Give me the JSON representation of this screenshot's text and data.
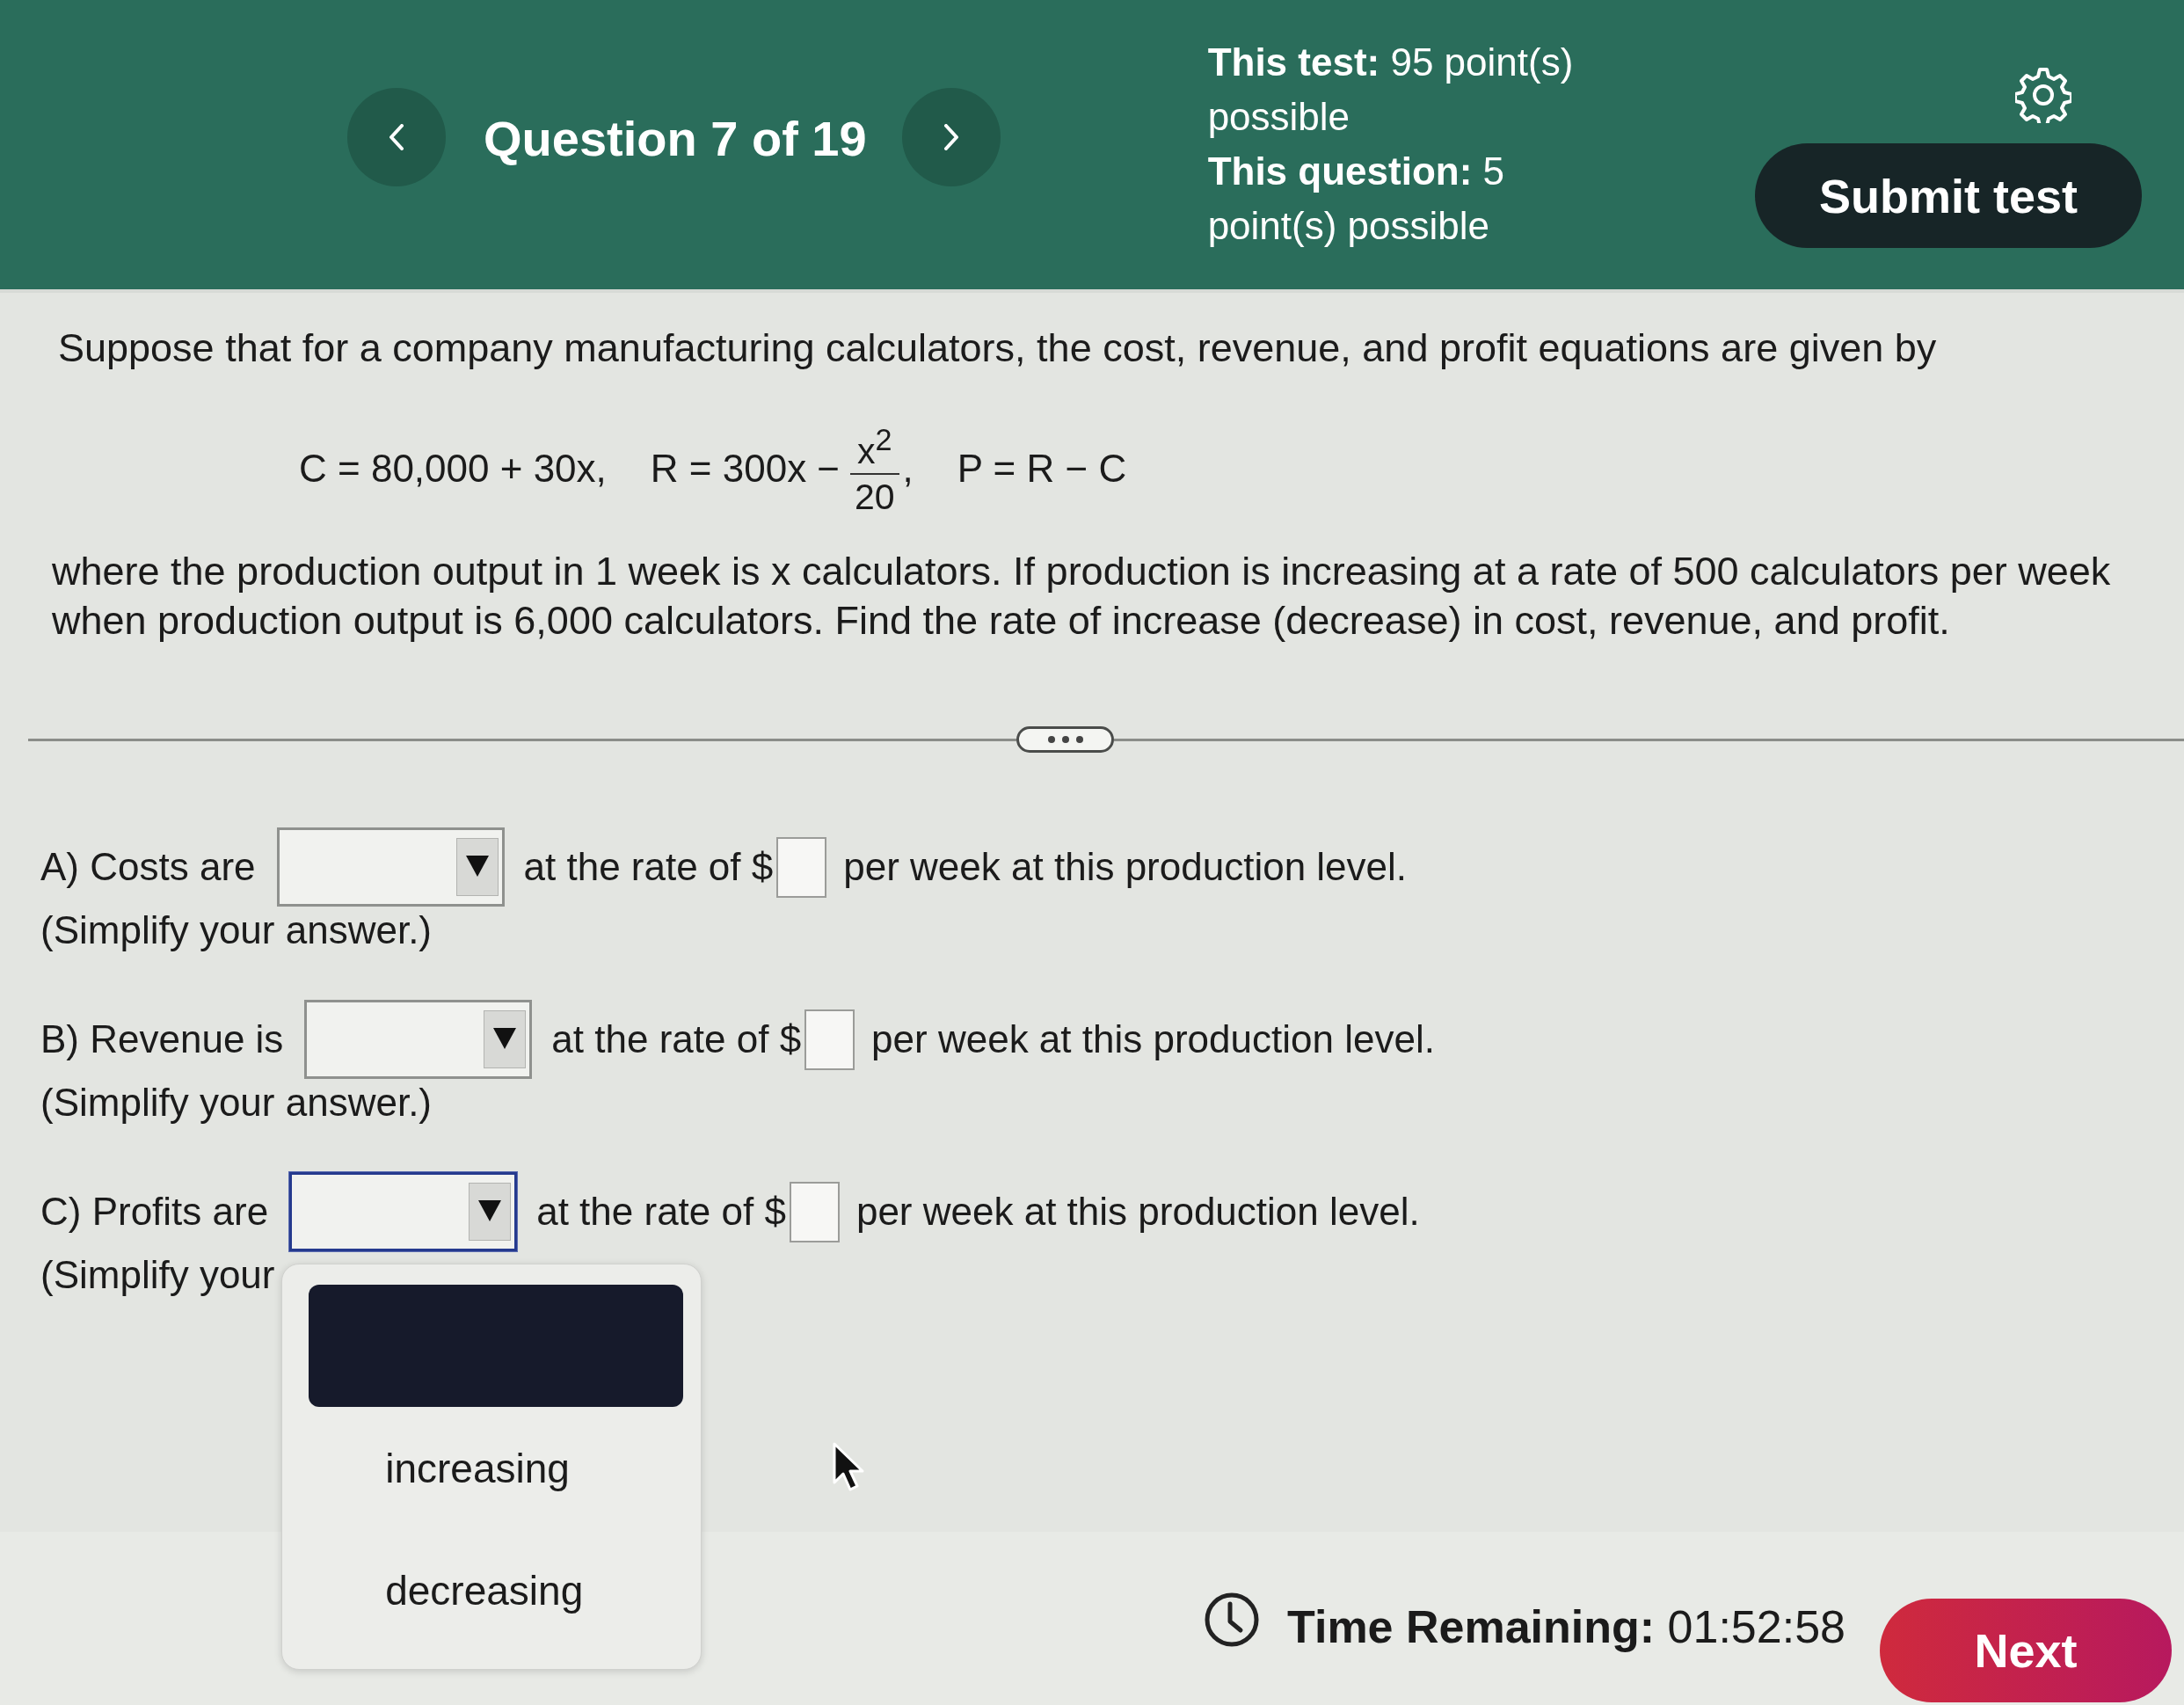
{
  "header": {
    "title": "Question 7 of 19",
    "points": [
      "**This test:** 95 point(s) possible",
      "**This question:** 5 point(s) possible"
    ],
    "submit_button": "Submit test"
  },
  "problem": {
    "intro": "Suppose that for a company manufacturing calculators, the cost, revenue, and profit equations are given by",
    "equations": [
      {
        "kind": "plain",
        "text": "C = 80,000 + 30x,"
      },
      {
        "kind": "fraction",
        "before": "R = 300x −",
        "numerator": "x$^{2}$",
        "denominator": "20",
        "after": ","
      },
      {
        "kind": "plain",
        "text": "P = R − C"
      }
    ],
    "body": "where the production output in 1 week is x calculators. If production is increasing at a rate of 500 calculators per week when production output is 6,000 calculators. Find the rate of increase (decrease) in cost, revenue, and profit."
  },
  "questions": [
    {
      "label": "A) Costs are",
      "dropdown": {
        "open": false
      },
      "rate_label": "at the rate of $",
      "suffix": "per week at this production level.",
      "note": "(Simplify your answer.)"
    },
    {
      "label": "B) Revenue is",
      "dropdown": {
        "open": false
      },
      "rate_label": "at the rate of $",
      "suffix": "per week at this production level.",
      "note": "(Simplify your answer.)"
    },
    {
      "label": "C) Profits are",
      "dropdown": {
        "open": true,
        "options": [
          {
            "kind": "blank",
            "highlighted": true
          },
          {
            "kind": "text",
            "label": "increasing",
            "highlighted": false
          },
          {
            "kind": "text",
            "label": "decreasing",
            "highlighted": false
          }
        ]
      },
      "rate_label": "at the rate of $",
      "suffix": "per week at this production level.",
      "note": "(Simplify your"
    }
  ],
  "footer": {
    "timer": "**Time Remaining:** 01:52:58",
    "next_button": "Next"
  }
}
